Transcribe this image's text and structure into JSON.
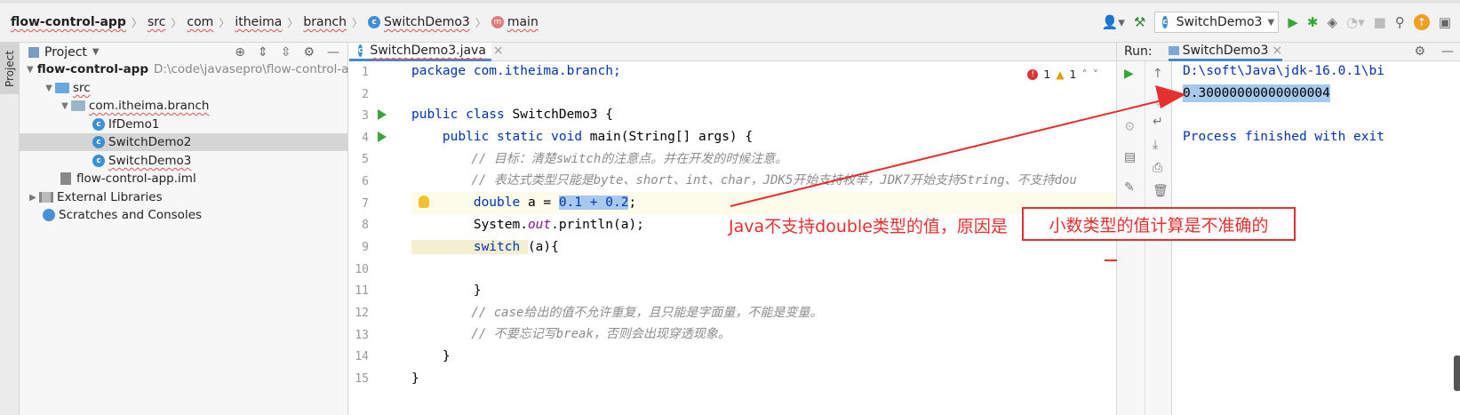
{
  "breadcrumbs": [
    {
      "label": "flow-control-app",
      "bold": true
    },
    {
      "label": "src"
    },
    {
      "label": "com"
    },
    {
      "label": "itheima"
    },
    {
      "label": "branch"
    },
    {
      "label": "SwitchDemo3",
      "icon": "c"
    },
    {
      "label": "main",
      "icon": "m"
    }
  ],
  "toolbar": {
    "run_config": "SwitchDemo3"
  },
  "sidebar": {
    "vertical_tab": "Project"
  },
  "project": {
    "title": "Project",
    "tree": [
      {
        "label": "flow-control-app",
        "path": "D:\\code\\javasepro\\flow-control-app",
        "depth": 0
      },
      {
        "label": "src",
        "depth": 1
      },
      {
        "label": "com.itheima.branch",
        "depth": 2
      },
      {
        "label": "IfDemo1",
        "depth": 3
      },
      {
        "label": "SwitchDemo2",
        "depth": 3,
        "selected": true
      },
      {
        "label": "SwitchDemo3",
        "depth": 3
      },
      {
        "label": "flow-control-app.iml",
        "depth": 2
      },
      {
        "label": "External Libraries",
        "depth": 0
      },
      {
        "label": "Scratches and Consoles",
        "depth": 0
      }
    ]
  },
  "editor": {
    "tab": "SwitchDemo3.java",
    "inspections": {
      "errors": "1",
      "warnings": "1"
    },
    "line_numbers": [
      "1",
      "2",
      "3",
      "4",
      "5",
      "6",
      "7",
      "8",
      "9",
      "10",
      "11",
      "12",
      "13",
      "14",
      "15"
    ],
    "lines": {
      "l1": "package com.itheima.branch;",
      "l3a": "public class ",
      "l3b": "SwitchDemo3 {",
      "l4a": "    public static void ",
      "l4b": "main(String[] args) {",
      "l5": "        // 目标：清楚switch的注意点。并在开发的时候注意。",
      "l6": "        // 表达式类型只能是byte、short、int、char，JDK5开始支持枚举，JDK7开始支持String、不支持dou",
      "l7a": "        double ",
      "l7b": "a = ",
      "l7c": "0.1 + 0.2",
      "l7d": ";",
      "l8a": "        System.",
      "l8b": "out",
      "l8c": ".println(a);",
      "l9a": "        switch ",
      "l9b": "(a){",
      "l11": "        }",
      "l12": "        // case给出的值不允许重复，且只能是字面量，不能是变量。",
      "l13": "        // 不要忘记写break，否则会出现穿透现象。",
      "l14": "    }",
      "l15": "}"
    }
  },
  "run": {
    "label": "Run:",
    "tab": "SwitchDemo3",
    "console": [
      "D:\\soft\\Java\\jdk-16.0.1\\bi",
      "0.30000000000000004",
      "",
      "Process finished with exit"
    ]
  },
  "annotation": {
    "text": "Java不支持double类型的值，原因是",
    "boxed": "小数类型的值计算是不准确的",
    "color": "#e53030"
  }
}
